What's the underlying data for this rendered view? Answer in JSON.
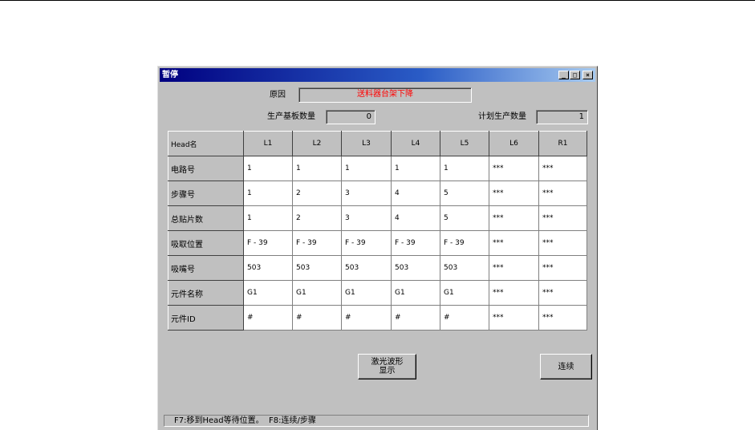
{
  "window": {
    "title": "暂停",
    "controls": {
      "minimize": "_",
      "maximize": "□",
      "close": "×"
    }
  },
  "reason": {
    "label": "原因",
    "value": "送料器台架下降"
  },
  "production": {
    "board_count_label": "生产基板数量",
    "board_count_value": "0",
    "planned_count_label": "计划生产数量",
    "planned_count_value": "1"
  },
  "table": {
    "corner": "Head名",
    "columns": [
      "L1",
      "L2",
      "L3",
      "L4",
      "L5",
      "L6",
      "R1"
    ],
    "rows": [
      {
        "label": "电路号",
        "cells": [
          "1",
          "1",
          "1",
          "1",
          "1",
          "***",
          "***"
        ]
      },
      {
        "label": "步骤号",
        "cells": [
          "1",
          "2",
          "3",
          "4",
          "5",
          "***",
          "***"
        ]
      },
      {
        "label": "总贴片数",
        "cells": [
          "1",
          "2",
          "3",
          "4",
          "5",
          "***",
          "***"
        ]
      },
      {
        "label": "吸取位置",
        "cells": [
          "F - 39",
          "F - 39",
          "F - 39",
          "F - 39",
          "F - 39",
          "***",
          "***"
        ]
      },
      {
        "label": "吸嘴号",
        "cells": [
          "503",
          "503",
          "503",
          "503",
          "503",
          "***",
          "***"
        ]
      },
      {
        "label": "元件名称",
        "cells": [
          "G1",
          "G1",
          "G1",
          "G1",
          "G1",
          "***",
          "***"
        ]
      },
      {
        "label": "元件ID",
        "cells": [
          "#",
          "#",
          "#",
          "#",
          "#",
          "***",
          "***"
        ]
      }
    ]
  },
  "buttons": {
    "laser_line1": "激光波形",
    "laser_line2": "显示",
    "continue": "连续"
  },
  "status": {
    "text": "F7:移到Head等待位置。  F8:连续/步骤"
  }
}
